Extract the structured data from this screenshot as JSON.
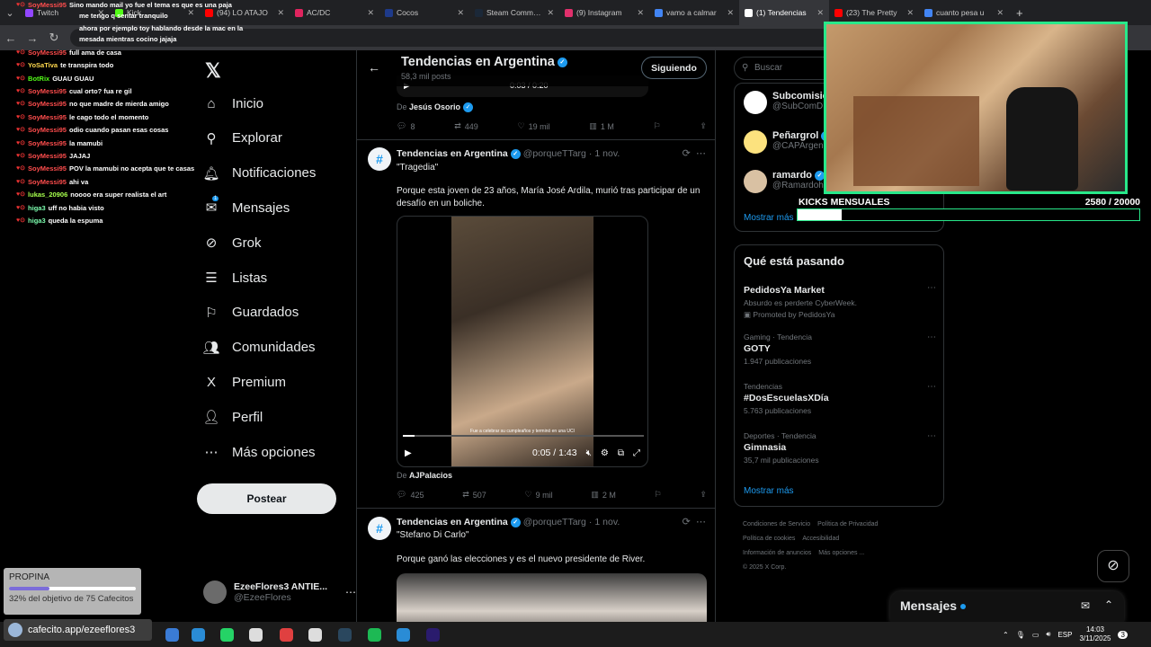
{
  "browser": {
    "tabs": [
      {
        "label": "Twitch",
        "color": "#9146ff"
      },
      {
        "label": "Kick",
        "color": "#53fc18"
      },
      {
        "label": "(94) LO ATAJO",
        "color": "#ff0000"
      },
      {
        "label": "AC/DC",
        "color": "#e0245e"
      },
      {
        "label": "Cocos",
        "color": "#1e3a8a"
      },
      {
        "label": "Steam Community",
        "color": "#1b2838"
      },
      {
        "label": "(9) Instagram",
        "color": "#e1306c"
      },
      {
        "label": "vamo a calmar",
        "color": "#4285f4"
      },
      {
        "label": "(1) Tendencias",
        "color": "#ffffff",
        "active": true
      },
      {
        "label": "(23) The Pretty",
        "color": "#ff0000"
      },
      {
        "label": "cuanto pesa u",
        "color": "#4285f4"
      }
    ]
  },
  "nav": {
    "items": [
      {
        "label": "Inicio",
        "icon": "home-icon",
        "glyph": "⌂"
      },
      {
        "label": "Explorar",
        "icon": "search-icon",
        "glyph": "⚲"
      },
      {
        "label": "Notificaciones",
        "icon": "bell-icon",
        "glyph": "🔔︎"
      },
      {
        "label": "Mensajes",
        "icon": "mail-icon",
        "glyph": "✉"
      },
      {
        "label": "Grok",
        "icon": "grok-icon",
        "glyph": "⊘"
      },
      {
        "label": "Listas",
        "icon": "list-icon",
        "glyph": "☰"
      },
      {
        "label": "Guardados",
        "icon": "bookmark-icon",
        "glyph": "⚐"
      },
      {
        "label": "Comunidades",
        "icon": "people-icon",
        "glyph": "👥︎"
      },
      {
        "label": "Premium",
        "icon": "x-icon",
        "glyph": "X"
      },
      {
        "label": "Perfil",
        "icon": "person-icon",
        "glyph": "👤︎"
      },
      {
        "label": "Más opciones",
        "icon": "more-icon",
        "glyph": "⋯"
      }
    ],
    "messages_badge": "1",
    "post_label": "Postear",
    "profile_name": "EzeeFlores3 ANTIE...",
    "profile_handle": "@EzeeFlores"
  },
  "header": {
    "title": "Tendencias en Argentina",
    "subtitle": "58,3 mil posts",
    "follow_label": "Siguiendo"
  },
  "top_tweet": {
    "time": "0:03 / 0:20",
    "from_label": "De",
    "from_name": "Jesús Osorio",
    "replies": "8",
    "retweets": "449",
    "likes": "19 mil",
    "views": "1 M"
  },
  "tweet1": {
    "name": "Tendencias en Argentina",
    "handle": "@porqueTTarg",
    "date": "1 nov.",
    "title": "\"Tragedia\"",
    "body": "Porque esta joven de 23 años, María José Ardila, murió tras participar de un desafío en un boliche.",
    "video_caption": "Fue a celebrar su cumpleaños y terminó en una UCI",
    "video_time": "0:05 / 1:43",
    "video_progress": 0.05,
    "from_label": "De",
    "from_name": "AJPalacios",
    "replies": "425",
    "retweets": "507",
    "likes": "9 mil",
    "views": "2 M"
  },
  "tweet2": {
    "name": "Tendencias en Argentina",
    "handle": "@porqueTTarg",
    "date": "1 nov.",
    "title": "\"Stefano Di Carlo\"",
    "body": "Porque ganó las elecciones y es el nuevo presidente de River."
  },
  "right": {
    "search_placeholder": "Buscar",
    "suggestions": [
      {
        "name": "Subcomisió",
        "handle": "@SubComD"
      },
      {
        "name": "Peñargrol",
        "handle": "@CAPArgen"
      },
      {
        "name": "ramardo",
        "handle": "@Ramardoh"
      }
    ],
    "show_more": "Mostrar más",
    "trends_title": "Qué está pasando",
    "trends": [
      {
        "context": "",
        "name": "PedidosYa Market",
        "sub": "Absurdo es perderte CyberWeek.",
        "promo": "Promoted by PedidosYa"
      },
      {
        "context": "Gaming · Tendencia",
        "name": "GOTY",
        "sub": "1.947 publicaciones",
        "promo": ""
      },
      {
        "context": "Tendencias",
        "name": "#DosEscuelasXDía",
        "sub": "5.763 publicaciones",
        "promo": ""
      },
      {
        "context": "Deportes · Tendencia",
        "name": "Gimnasia",
        "sub": "35,7 mil publicaciones",
        "promo": ""
      }
    ],
    "trends_more": "Mostrar más",
    "footer": [
      "Condiciones de Servicio",
      "Política de Privacidad",
      "Política de cookies",
      "Accesibilidad",
      "Información de anuncios",
      "Más opciones ...",
      "© 2025 X Corp."
    ]
  },
  "messages": {
    "title": "Mensajes"
  },
  "chat": [
    {
      "user": "SoyMessi95",
      "msg": "Sino mando mail yo fue el tema es que es una paja"
    },
    {
      "user": "",
      "msg": "me tengo q sentar tranquilo"
    },
    {
      "user": "",
      "msg": "ahora por ejemplo toy hablando desde la mac en la"
    },
    {
      "user": "",
      "msg": "mesada mientras cocino jajaja"
    },
    {
      "user": "SoyMessi95",
      "msg": "full ama de casa"
    },
    {
      "user": "YoSaTiva",
      "msg": "te transpira todo"
    },
    {
      "user": "BotRix",
      "msg": "GUAU GUAU"
    },
    {
      "user": "SoyMessi95",
      "msg": "cual orto? fua re gil"
    },
    {
      "user": "SoyMessi95",
      "msg": "no que madre de mierda amigo"
    },
    {
      "user": "SoyMessi95",
      "msg": "le cago todo el momento"
    },
    {
      "user": "SoyMessi95",
      "msg": "odio cuando pasan esas cosas"
    },
    {
      "user": "SoyMessi95",
      "msg": "la mamubi"
    },
    {
      "user": "SoyMessi95",
      "msg": "JAJAJ"
    },
    {
      "user": "SoyMessi95",
      "msg": "POV la mamubi no acepta que te casas"
    },
    {
      "user": "SoyMessi95",
      "msg": "ahi va"
    },
    {
      "user": "lukas_20906",
      "msg": "noooo era super realista el art"
    },
    {
      "user": "higa3",
      "msg": "uff no habia visto"
    },
    {
      "user": "higa3",
      "msg": "queda la espuma"
    }
  ],
  "stream": {
    "kicks_label": "KICKS MENSUALES",
    "kicks_value": "2580   /  20000",
    "kicks_progress": 0.129,
    "tip_title": "PROPINA",
    "tip_progress": 0.32,
    "tip_text": "32% del objetivo de 75 Cafecitos",
    "cafecito": "cafecito.app/ezeeflores3"
  },
  "taskbar": {
    "lang": "ESP",
    "time": "14:03",
    "date": "3/11/2025",
    "notif": "3"
  },
  "colors": {
    "accent": "#1d9bf0",
    "kick": "#28e88a"
  }
}
